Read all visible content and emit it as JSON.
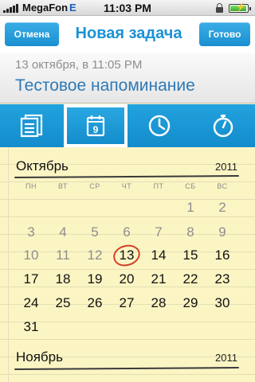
{
  "status_bar": {
    "carrier": "MegaFon",
    "network": "E",
    "time": "11:03 PM",
    "battery_level": 1.0
  },
  "navbar": {
    "cancel_label": "Отмена",
    "title": "Новая задача",
    "done_label": "Готово"
  },
  "task": {
    "date_line": "13 октября, в 11:05 PM",
    "title": "Тестовое напоминание"
  },
  "tabs": [
    {
      "icon": "notes-icon",
      "active": false
    },
    {
      "icon": "calendar-icon",
      "label": "9",
      "active": true
    },
    {
      "icon": "clock-icon",
      "active": false
    },
    {
      "icon": "stopwatch-icon",
      "active": false
    }
  ],
  "colors": {
    "accent": "#1a92d6",
    "paper": "#fbf5c4",
    "today_ring": "#d2412b"
  },
  "calendar": {
    "weekdays": [
      "ПН",
      "ВТ",
      "СР",
      "ЧТ",
      "ПТ",
      "СБ",
      "ВС"
    ],
    "months": [
      {
        "name": "Октябрь",
        "year": "2011",
        "selected_day": "13",
        "weeks": [
          [
            {
              "d": "",
              "m": false
            },
            {
              "d": "",
              "m": false
            },
            {
              "d": "",
              "m": false
            },
            {
              "d": "",
              "m": false
            },
            {
              "d": "",
              "m": false
            },
            {
              "d": "1",
              "m": true
            },
            {
              "d": "2",
              "m": true
            }
          ],
          [
            {
              "d": "3",
              "m": true
            },
            {
              "d": "4",
              "m": true
            },
            {
              "d": "5",
              "m": true
            },
            {
              "d": "6",
              "m": true
            },
            {
              "d": "7",
              "m": true
            },
            {
              "d": "8",
              "m": true
            },
            {
              "d": "9",
              "m": true
            }
          ],
          [
            {
              "d": "10",
              "m": true
            },
            {
              "d": "11",
              "m": true
            },
            {
              "d": "12",
              "m": true
            },
            {
              "d": "13",
              "m": false
            },
            {
              "d": "14",
              "m": false
            },
            {
              "d": "15",
              "m": false
            },
            {
              "d": "16",
              "m": false
            }
          ],
          [
            {
              "d": "17",
              "m": false
            },
            {
              "d": "18",
              "m": false
            },
            {
              "d": "19",
              "m": false
            },
            {
              "d": "20",
              "m": false
            },
            {
              "d": "21",
              "m": false
            },
            {
              "d": "22",
              "m": false
            },
            {
              "d": "23",
              "m": false
            }
          ],
          [
            {
              "d": "24",
              "m": false
            },
            {
              "d": "25",
              "m": false
            },
            {
              "d": "26",
              "m": false
            },
            {
              "d": "27",
              "m": false
            },
            {
              "d": "28",
              "m": false
            },
            {
              "d": "29",
              "m": false
            },
            {
              "d": "30",
              "m": false
            }
          ],
          [
            {
              "d": "31",
              "m": false
            }
          ]
        ]
      },
      {
        "name": "Ноябрь",
        "year": "2011"
      }
    ]
  }
}
